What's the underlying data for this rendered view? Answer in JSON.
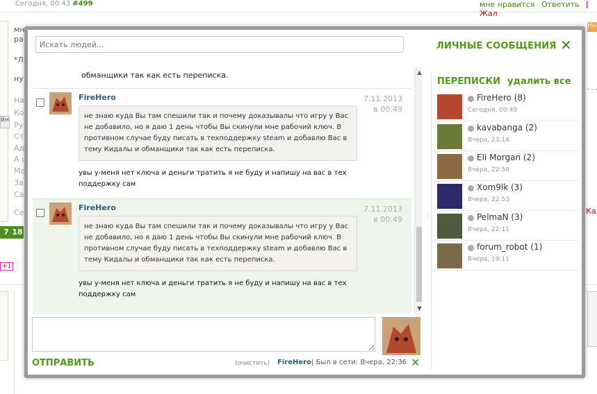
{
  "background": {
    "meta_date": "Сегодня, 00:43",
    "meta_num": "#499",
    "action_like": "мне нравится",
    "action_reply": "Ответить",
    "action_complain": "[ Жал",
    "left_lines": [
      "мн",
      "ра",
      "*Л",
      "ну"
    ],
    "left_grey": [
      "На",
      "Ко",
      "Ру",
      "Ст",
      "Ад",
      "А ц",
      "Мо",
      "За",
      "Са",
      "Се"
    ],
    "tab_text": "йн",
    "pages": [
      "7",
      "18"
    ],
    "plus_badge": "+1",
    "right_badge": "На",
    "right_red": "Кал"
  },
  "modal": {
    "search_placeholder": "Искать людей...",
    "title": "ЛИЧНЫЕ СООБЩЕНИЯ",
    "close": "✕",
    "top_snippet": "обманщики так как есть переписка.",
    "messages": [
      {
        "author": "FireHero",
        "date": "7.11.2013",
        "time": "в 00:49",
        "quote": "не знаю куда Вы там спешили так и почему доказывалы что игру у Вас не добавило, но я даю 1 день чтобы Вы скинули мне рабочий ключ. В противном случае буду писать в техподдержку steam и добавлю Вас в тему Кидалы и обманщики так как есть переписка.",
        "body": "увы у-меня нет ключа и деньги тратить я не буду и напишу на вас в тех поддержку сам"
      },
      {
        "author": "FireHero",
        "date": "7.11.2013",
        "time": "в 00:49",
        "quote": "не знаю куда Вы там спешили так и почему доказывалы что игру у Вас не добавило, но я даю 1 день чтобы Вы скинули мне рабочий ключ. В противном случае буду писать в техподдержку steam и добавлю Вас в тему Кидалы и обманщики так как есть переписка.",
        "body": "увы у-меня нет ключа и деньги тратить я не буду и напишу на вас в тех поддержку сам"
      }
    ],
    "send_label": "ОТПРАВИТЬ",
    "clear_label": "(очистить)",
    "status_name": "FireHero",
    "status_text": "| Был в сети: Вчера, 22:36",
    "conversations_title": "ПЕРЕПИСКИ",
    "delete_all": "удалить все",
    "conversations": [
      {
        "name": "FireHero (8)",
        "time": "Сегодня, 00:49",
        "avatar_color": "#b5482c"
      },
      {
        "name": "kavabanga (2)",
        "time": "Вчера, 23:14",
        "avatar_color": "#6c7a3a"
      },
      {
        "name": "Eli Morgan (2)",
        "time": "Вчера, 22:58",
        "avatar_color": "#8c6a43"
      },
      {
        "name": "Xom9lk (3)",
        "time": "Вчера, 22:53",
        "avatar_color": "#2a2c6a"
      },
      {
        "name": "PelmaN (3)",
        "time": "Вчера, 22:11",
        "avatar_color": "#4d5a3b"
      },
      {
        "name": "forum_robot (1)",
        "time": "Вчера, 19:11",
        "avatar_color": "#7b6a4a"
      }
    ]
  },
  "colors": {
    "accent": "#4e9a15",
    "author": "#2c5d7a",
    "alt_row": "#eef5ea"
  }
}
